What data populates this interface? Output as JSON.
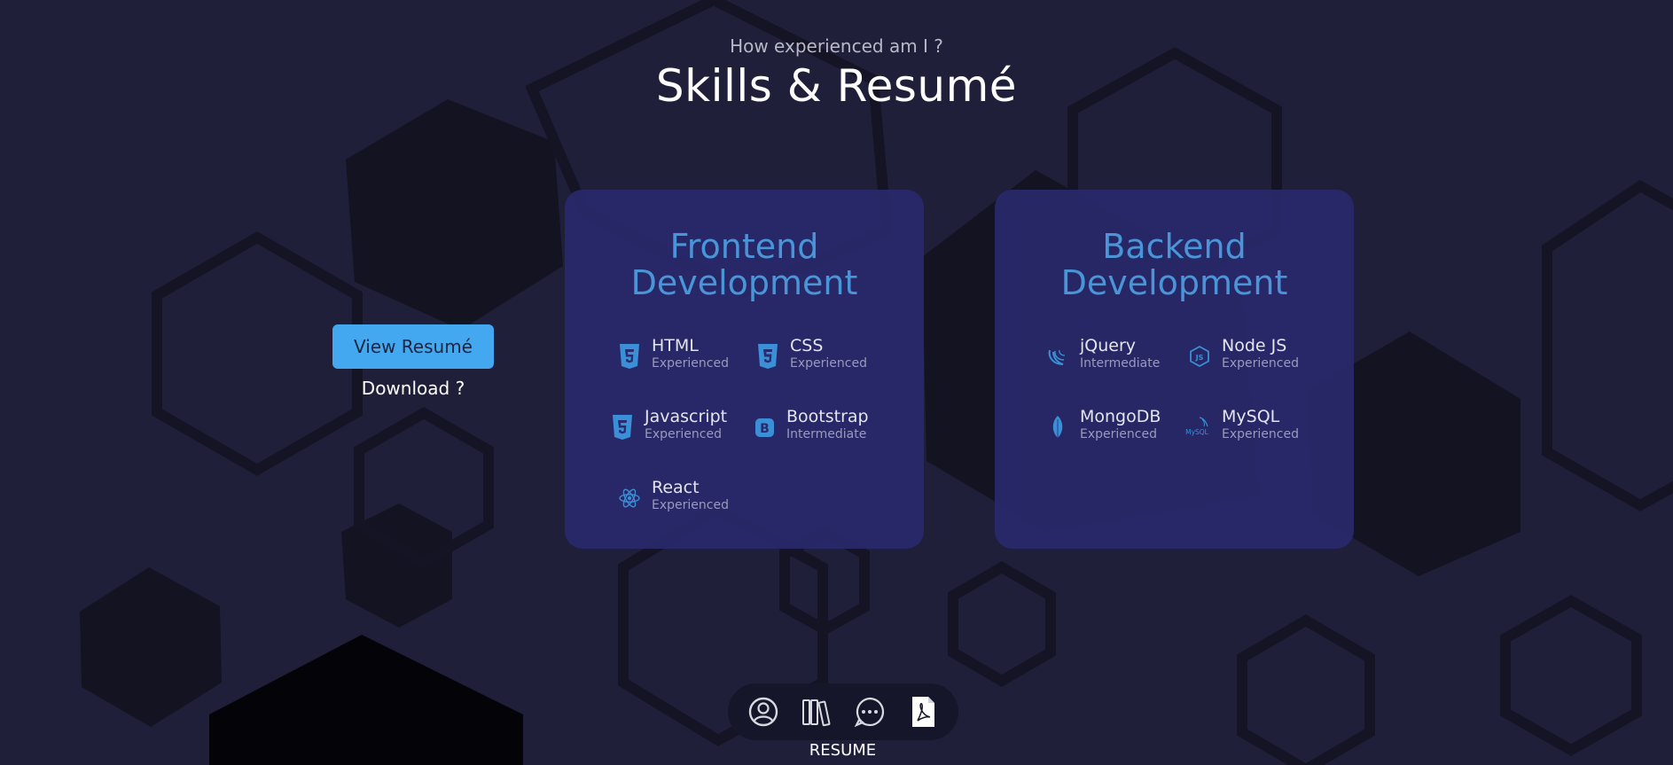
{
  "header": {
    "subtitle": "How experienced am I ?",
    "title": "Skills & Resumé"
  },
  "resume": {
    "view_label": "View Resumé",
    "download_label": "Download ?"
  },
  "cards": [
    {
      "title_line1": "Frontend",
      "title_line2": "Development",
      "skills": [
        {
          "name": "HTML",
          "level": "Experienced",
          "icon": "html5-icon"
        },
        {
          "name": "CSS",
          "level": "Experienced",
          "icon": "css3-icon"
        },
        {
          "name": "Javascript",
          "level": "Experienced",
          "icon": "html5-icon"
        },
        {
          "name": "Bootstrap",
          "level": "Intermediate",
          "icon": "bootstrap-icon"
        },
        {
          "name": "React",
          "level": "Experienced",
          "icon": "react-icon"
        }
      ]
    },
    {
      "title_line1": "Backend",
      "title_line2": "Development",
      "skills": [
        {
          "name": "jQuery",
          "level": "Intermediate",
          "icon": "jquery-icon"
        },
        {
          "name": "Node JS",
          "level": "Experienced",
          "icon": "nodejs-icon"
        },
        {
          "name": "MongoDB",
          "level": "Experienced",
          "icon": "mongodb-leaf-icon"
        },
        {
          "name": "MySQL",
          "level": "Experienced",
          "icon": "mysql-icon"
        }
      ]
    }
  ],
  "dock": {
    "items": [
      {
        "icon": "user-circle-icon"
      },
      {
        "icon": "books-icon"
      },
      {
        "icon": "chat-bubble-icon"
      },
      {
        "icon": "pdf-file-icon",
        "active": true
      }
    ],
    "active_label": "RESUME"
  },
  "colors": {
    "background": "#1f1f3a",
    "card": "#2a2a6e",
    "accent": "#43a8ef",
    "card_title": "#4a95d8",
    "skill_level": "#9a9abb"
  }
}
